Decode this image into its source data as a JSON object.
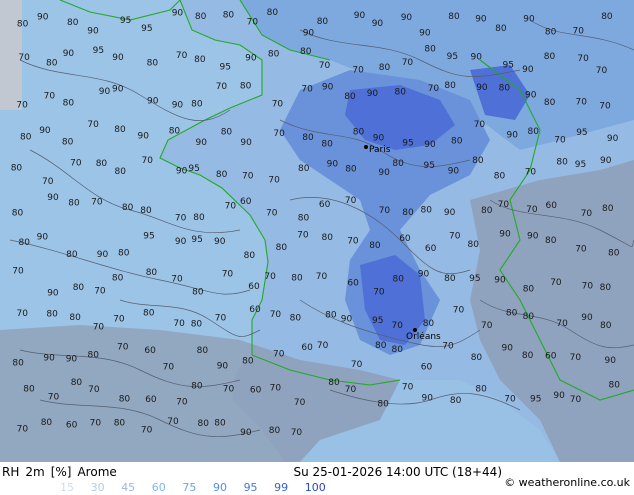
{
  "header": {
    "parameter": "RH",
    "level": "2m",
    "unit": "[%]",
    "model": "Arome",
    "datetime": "Su 25-01-2026 14:00 UTC (18+44)",
    "copyright": "© weatheronline.co.uk"
  },
  "legend": {
    "values": [
      {
        "label": "15",
        "color": "#d3dcec"
      },
      {
        "label": "30",
        "color": "#b7c9e4"
      },
      {
        "label": "45",
        "color": "#9fb7dc"
      },
      {
        "label": "60",
        "color": "#7fb8e8"
      },
      {
        "label": "75",
        "color": "#6aa6e0"
      },
      {
        "label": "90",
        "color": "#5b8ede"
      },
      {
        "label": "95",
        "color": "#4a76d8"
      },
      {
        "label": "99",
        "color": "#3a5fd0"
      },
      {
        "label": "100",
        "color": "#2848c4"
      }
    ]
  },
  "colors": {
    "sea": "#9cc4e6",
    "land_low": "#95bbe4",
    "land_mid": "#7ea9df",
    "land_high": "#6a92da",
    "land_max": "#4f70d6",
    "mountains": "#8a8fa0",
    "no_data": "#c6c9cf",
    "border": "#22aa22",
    "contour": "#555e70"
  },
  "cities": [
    {
      "name": "Paris"
    },
    {
      "name": "Orléans"
    }
  ],
  "contour_labels": [
    {
      "text": "80"
    },
    {
      "text": "90"
    },
    {
      "text": "80"
    },
    {
      "text": "90"
    },
    {
      "text": "95"
    },
    {
      "text": "95"
    },
    {
      "text": "90"
    },
    {
      "text": "80"
    },
    {
      "text": "80"
    },
    {
      "text": "70"
    },
    {
      "text": "80"
    },
    {
      "text": "90"
    },
    {
      "text": "80"
    },
    {
      "text": "90"
    },
    {
      "text": "90"
    },
    {
      "text": "90"
    },
    {
      "text": "90"
    },
    {
      "text": "80"
    },
    {
      "text": "90"
    },
    {
      "text": "80"
    },
    {
      "text": "90"
    },
    {
      "text": "80"
    },
    {
      "text": "70"
    },
    {
      "text": "80"
    },
    {
      "text": "70"
    },
    {
      "text": "80"
    },
    {
      "text": "90"
    },
    {
      "text": "95"
    },
    {
      "text": "90"
    },
    {
      "text": "80"
    },
    {
      "text": "70"
    },
    {
      "text": "80"
    },
    {
      "text": "95"
    },
    {
      "text": "90"
    },
    {
      "text": "80"
    },
    {
      "text": "80"
    },
    {
      "text": "70"
    },
    {
      "text": "70"
    },
    {
      "text": "80"
    },
    {
      "text": "70"
    },
    {
      "text": "80"
    },
    {
      "text": "95"
    },
    {
      "text": "90"
    },
    {
      "text": "95"
    },
    {
      "text": "90"
    },
    {
      "text": "80"
    },
    {
      "text": "70"
    },
    {
      "text": "70"
    },
    {
      "text": "70"
    },
    {
      "text": "70"
    },
    {
      "text": "80"
    },
    {
      "text": "90"
    },
    {
      "text": "90"
    },
    {
      "text": "90"
    },
    {
      "text": "90"
    },
    {
      "text": "80"
    },
    {
      "text": "70"
    },
    {
      "text": "80"
    },
    {
      "text": "70"
    },
    {
      "text": "70"
    },
    {
      "text": "90"
    },
    {
      "text": "80"
    },
    {
      "text": "90"
    },
    {
      "text": "80"
    },
    {
      "text": "70"
    },
    {
      "text": "80"
    },
    {
      "text": "90"
    },
    {
      "text": "80"
    },
    {
      "text": "90"
    },
    {
      "text": "80"
    },
    {
      "text": "70"
    },
    {
      "text": "70"
    },
    {
      "text": "80"
    },
    {
      "text": "90"
    },
    {
      "text": "80"
    },
    {
      "text": "70"
    },
    {
      "text": "80"
    },
    {
      "text": "90"
    },
    {
      "text": "80"
    },
    {
      "text": "90"
    },
    {
      "text": "80"
    },
    {
      "text": "90"
    },
    {
      "text": "70"
    },
    {
      "text": "80"
    },
    {
      "text": "80"
    },
    {
      "text": "80"
    },
    {
      "text": "90"
    },
    {
      "text": "95"
    },
    {
      "text": "90"
    },
    {
      "text": "80"
    },
    {
      "text": "70"
    },
    {
      "text": "90"
    },
    {
      "text": "80"
    },
    {
      "text": "70"
    },
    {
      "text": "95"
    },
    {
      "text": "90"
    },
    {
      "text": "80"
    },
    {
      "text": "70"
    },
    {
      "text": "70"
    },
    {
      "text": "80"
    },
    {
      "text": "80"
    },
    {
      "text": "70"
    },
    {
      "text": "90"
    },
    {
      "text": "95"
    },
    {
      "text": "80"
    },
    {
      "text": "70"
    },
    {
      "text": "70"
    },
    {
      "text": "80"
    },
    {
      "text": "90"
    },
    {
      "text": "80"
    },
    {
      "text": "90"
    },
    {
      "text": "80"
    },
    {
      "text": "95"
    },
    {
      "text": "90"
    },
    {
      "text": "80"
    },
    {
      "text": "80"
    },
    {
      "text": "70"
    },
    {
      "text": "80"
    },
    {
      "text": "95"
    },
    {
      "text": "90"
    },
    {
      "text": "80"
    },
    {
      "text": "90"
    },
    {
      "text": "80"
    },
    {
      "text": "70"
    },
    {
      "text": "80"
    },
    {
      "text": "80"
    },
    {
      "text": "70"
    },
    {
      "text": "80"
    },
    {
      "text": "70"
    },
    {
      "text": "60"
    },
    {
      "text": "70"
    },
    {
      "text": "80"
    },
    {
      "text": "60"
    },
    {
      "text": "70"
    },
    {
      "text": "70"
    },
    {
      "text": "80"
    },
    {
      "text": "80"
    },
    {
      "text": "90"
    },
    {
      "text": "80"
    },
    {
      "text": "70"
    },
    {
      "text": "70"
    },
    {
      "text": "60"
    },
    {
      "text": "70"
    },
    {
      "text": "80"
    },
    {
      "text": "80"
    },
    {
      "text": "90"
    },
    {
      "text": "80"
    },
    {
      "text": "90"
    },
    {
      "text": "80"
    },
    {
      "text": "95"
    },
    {
      "text": "90"
    },
    {
      "text": "95"
    },
    {
      "text": "90"
    },
    {
      "text": "80"
    },
    {
      "text": "80"
    },
    {
      "text": "70"
    },
    {
      "text": "80"
    },
    {
      "text": "70"
    },
    {
      "text": "80"
    },
    {
      "text": "60"
    },
    {
      "text": "60"
    },
    {
      "text": "70"
    },
    {
      "text": "80"
    },
    {
      "text": "90"
    },
    {
      "text": "90"
    },
    {
      "text": "80"
    },
    {
      "text": "70"
    },
    {
      "text": "80"
    },
    {
      "text": "70"
    },
    {
      "text": "90"
    },
    {
      "text": "80"
    },
    {
      "text": "70"
    },
    {
      "text": "80"
    },
    {
      "text": "80"
    },
    {
      "text": "70"
    },
    {
      "text": "80"
    },
    {
      "text": "70"
    },
    {
      "text": "60"
    },
    {
      "text": "70"
    },
    {
      "text": "80"
    },
    {
      "text": "70"
    },
    {
      "text": "60"
    },
    {
      "text": "70"
    },
    {
      "text": "80"
    },
    {
      "text": "90"
    },
    {
      "text": "80"
    },
    {
      "text": "95"
    },
    {
      "text": "90"
    },
    {
      "text": "80"
    },
    {
      "text": "70"
    },
    {
      "text": "70"
    },
    {
      "text": "80"
    },
    {
      "text": "70"
    },
    {
      "text": "80"
    },
    {
      "text": "80"
    },
    {
      "text": "70"
    },
    {
      "text": "70"
    },
    {
      "text": "80"
    },
    {
      "text": "70"
    },
    {
      "text": "80"
    },
    {
      "text": "70"
    },
    {
      "text": "60"
    },
    {
      "text": "70"
    },
    {
      "text": "80"
    },
    {
      "text": "80"
    },
    {
      "text": "90"
    },
    {
      "text": "95"
    },
    {
      "text": "70"
    },
    {
      "text": "80"
    },
    {
      "text": "70"
    },
    {
      "text": "70"
    },
    {
      "text": "80"
    },
    {
      "text": "80"
    },
    {
      "text": "70"
    },
    {
      "text": "90"
    },
    {
      "text": "80"
    },
    {
      "text": "80"
    },
    {
      "text": "90"
    },
    {
      "text": "90"
    },
    {
      "text": "80"
    },
    {
      "text": "70"
    },
    {
      "text": "60"
    },
    {
      "text": "70"
    },
    {
      "text": "80"
    },
    {
      "text": "90"
    },
    {
      "text": "80"
    },
    {
      "text": "70"
    },
    {
      "text": "60"
    },
    {
      "text": "70"
    },
    {
      "text": "70"
    },
    {
      "text": "80"
    },
    {
      "text": "80"
    },
    {
      "text": "60"
    },
    {
      "text": "70"
    },
    {
      "text": "80"
    },
    {
      "text": "90"
    },
    {
      "text": "80"
    },
    {
      "text": "60"
    },
    {
      "text": "70"
    },
    {
      "text": "90"
    },
    {
      "text": "80"
    },
    {
      "text": "70"
    },
    {
      "text": "80"
    },
    {
      "text": "70"
    },
    {
      "text": "80"
    },
    {
      "text": "60"
    },
    {
      "text": "70"
    },
    {
      "text": "80"
    },
    {
      "text": "70"
    },
    {
      "text": "60"
    },
    {
      "text": "70"
    },
    {
      "text": "70"
    },
    {
      "text": "80"
    },
    {
      "text": "70"
    },
    {
      "text": "80"
    },
    {
      "text": "70"
    },
    {
      "text": "90"
    },
    {
      "text": "80"
    },
    {
      "text": "80"
    },
    {
      "text": "70"
    },
    {
      "text": "95"
    },
    {
      "text": "90"
    },
    {
      "text": "70"
    },
    {
      "text": "80"
    },
    {
      "text": "70"
    },
    {
      "text": "80"
    },
    {
      "text": "60"
    },
    {
      "text": "70"
    },
    {
      "text": "80"
    },
    {
      "text": "70"
    },
    {
      "text": "70"
    },
    {
      "text": "80"
    },
    {
      "text": "80"
    },
    {
      "text": "90"
    },
    {
      "text": "80"
    },
    {
      "text": "70"
    }
  ]
}
